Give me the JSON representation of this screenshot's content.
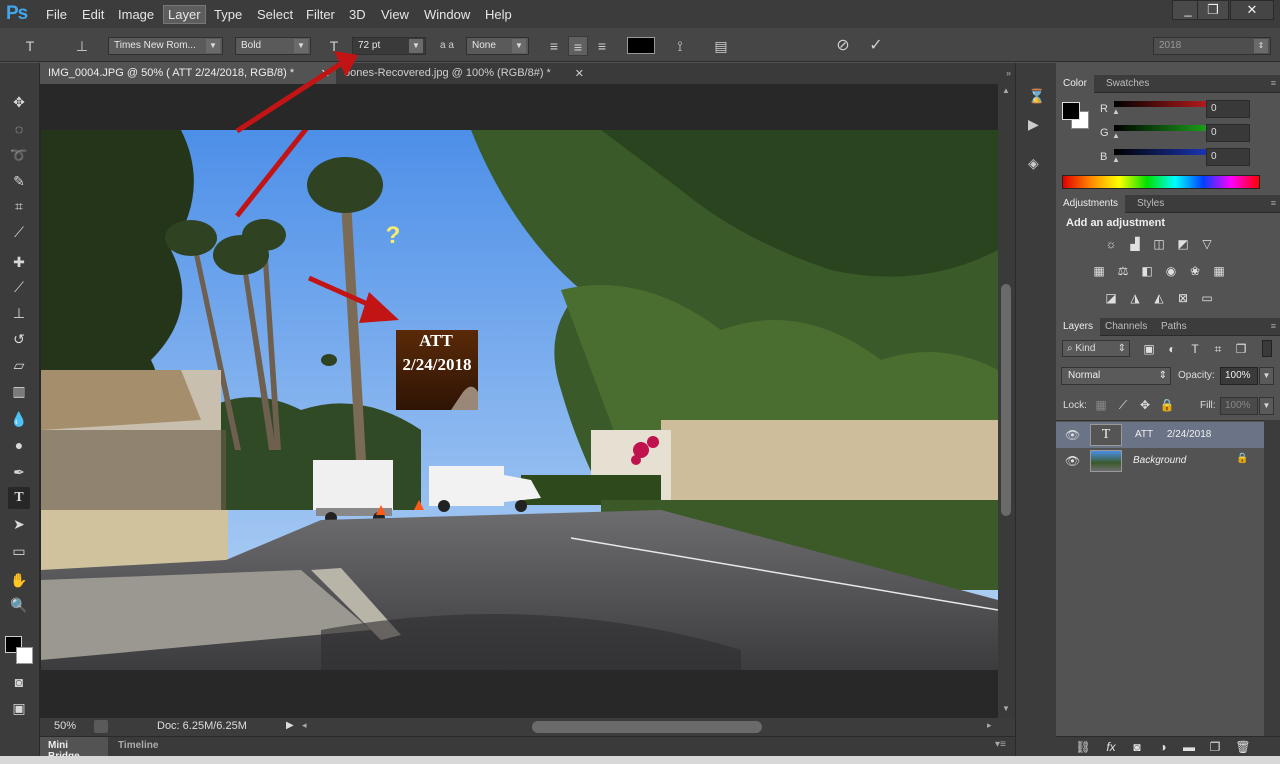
{
  "app": {
    "logo": "Ps"
  },
  "menu": [
    "File",
    "Edit",
    "Image",
    "Layer",
    "Type",
    "Select",
    "Filter",
    "3D",
    "View",
    "Window",
    "Help"
  ],
  "options": {
    "font_family": "Times New Rom...",
    "font_style": "Bold",
    "font_size": "72 pt",
    "aa_label": "a a",
    "antialias": "None",
    "workspace": "2018"
  },
  "tabs": [
    {
      "label": "IMG_0004.JPG @ 50% ( ATT     2/24/2018, RGB/8) *"
    },
    {
      "label": "oones-Recovered.jpg @ 100% (RGB/8#) *"
    }
  ],
  "canvas": {
    "question_mark": "?",
    "text_line1": "ATT",
    "text_line2": "2/24/2018"
  },
  "status": {
    "zoom": "50%",
    "doc": "Doc: 6.25M/6.25M"
  },
  "bottom_tabs": [
    "Mini Bridge",
    "Timeline"
  ],
  "color_panel": {
    "tabs": [
      "Color",
      "Swatches"
    ],
    "channels": [
      {
        "label": "R",
        "value": "0",
        "color": "#d82020"
      },
      {
        "label": "G",
        "value": "0",
        "color": "#20c020"
      },
      {
        "label": "B",
        "value": "0",
        "color": "#2040d8"
      }
    ]
  },
  "adjustments_panel": {
    "tabs": [
      "Adjustments",
      "Styles"
    ],
    "heading": "Add an adjustment"
  },
  "layers_panel": {
    "tabs": [
      "Layers",
      "Channels",
      "Paths"
    ],
    "filter_label": "Kind",
    "blend_mode": "Normal",
    "opacity_label": "Opacity:",
    "opacity": "100%",
    "lock_label": "Lock:",
    "fill_label": "Fill:",
    "fill": "100%",
    "layers": [
      {
        "name": "ATT     2/24/2018",
        "type": "text"
      },
      {
        "name": "Background",
        "type": "image"
      }
    ]
  }
}
